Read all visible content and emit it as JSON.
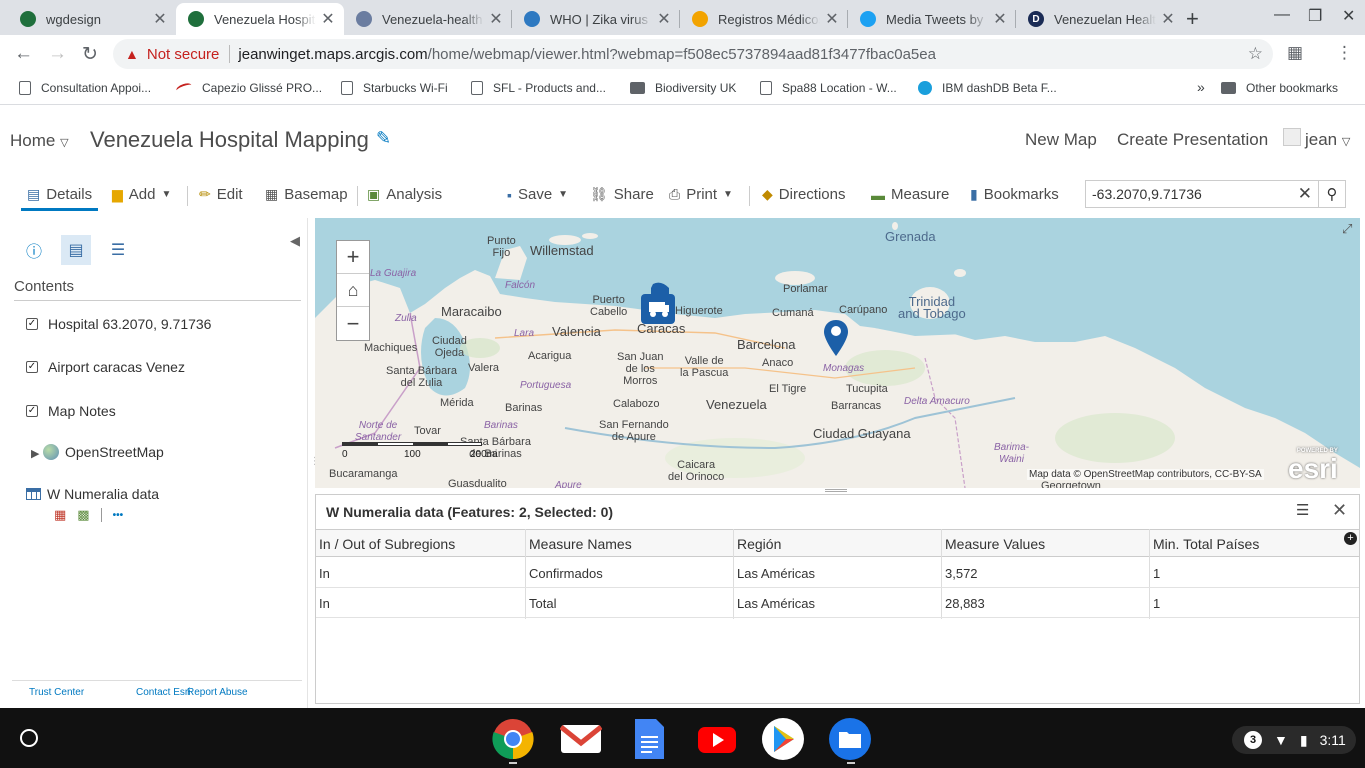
{
  "browser": {
    "tabs": [
      {
        "title": "wgdesign",
        "favicon_color": "#1f6f3c",
        "active": false
      },
      {
        "title": "Venezuela Hospital Mapping",
        "favicon_color": "#1f6f3c",
        "active": true
      },
      {
        "title": "Venezuela-health",
        "favicon_color": "#6b7da0",
        "active": false
      },
      {
        "title": "WHO | Zika virus",
        "favicon_color": "#2e79c1",
        "active": false
      },
      {
        "title": "Registros Médicos",
        "favicon_color": "#f2a300",
        "active": false
      },
      {
        "title": "Media Tweets by",
        "favicon_color": "#1da1f2",
        "active": false
      },
      {
        "title": "Venezuelan Health",
        "favicon_color": "#1a2b55",
        "active": false
      }
    ],
    "not_secure": "Not secure",
    "url_host": "jeanwinget.maps.arcgis.com",
    "url_path": "/home/webmap/viewer.html?webmap=f508ec5737894aad81f3477fbac0a5ea",
    "bookmarks": [
      {
        "label": "Consultation Appoi...",
        "icon": "page-icon"
      },
      {
        "label": "Capezio Glissé PRO...",
        "icon": "swoosh-icon"
      },
      {
        "label": "Starbucks Wi-Fi",
        "icon": "page-icon"
      },
      {
        "label": "SFL - Products and...",
        "icon": "page-icon"
      },
      {
        "label": "Biodiversity UK",
        "icon": "folder-icon"
      },
      {
        "label": "Spa88 Location - W...",
        "icon": "page-icon"
      },
      {
        "label": "IBM dashDB Beta F...",
        "icon": "ibm-icon"
      }
    ],
    "overflow": "»",
    "other_bookmarks": "Other bookmarks"
  },
  "header": {
    "home": "Home",
    "title": "Venezuela Hospital Mapping",
    "new_map": "New Map",
    "create_presentation": "Create Presentation",
    "user": "jean"
  },
  "toolbar": {
    "details": "Details",
    "add": "Add",
    "edit": "Edit",
    "basemap": "Basemap",
    "analysis": "Analysis",
    "save": "Save",
    "share": "Share",
    "print": "Print",
    "directions": "Directions",
    "measure": "Measure",
    "bookmarks": "Bookmarks",
    "search_value": "-63.2070,9.71736"
  },
  "contents": {
    "heading": "Contents",
    "layers": [
      {
        "label": "Hospital 63.2070, 9.71736",
        "checked": true
      },
      {
        "label": "Airport caracas Venez",
        "checked": true
      },
      {
        "label": "Map Notes",
        "checked": true
      }
    ],
    "basemap_layer": "OpenStreetMap",
    "table_layer": "W Numeralia data",
    "more": "•••",
    "footer": {
      "trust": "Trust Center",
      "contact": "Contact Esri",
      "abuse": "Report Abuse"
    }
  },
  "map": {
    "labels": {
      "grenada": "Grenada",
      "punto_fijo": "Punto\nFijo",
      "willemstad": "Willemstad",
      "la_guajira": "La Guajira",
      "falcon": "Falcón",
      "puerto_cabello": "Puerto\nCabello",
      "higuerote": "Higuerote",
      "porlamar": "Porlamar",
      "carupano": "Carúpano",
      "trinidad": "Trinidad\nand Tobago",
      "zulia": "Zulia",
      "maracaibo": "Maracaibo",
      "lara": "Lara",
      "valencia": "Valencia",
      "caracas": "Caracas",
      "cumana": "Cumaná",
      "machiques": "Machiques",
      "ciudad_ojeda": "Ciudad\nOjeda",
      "acarigua": "Acarigua",
      "san_juan": "San Juan\nde los\nMorros",
      "valle": "Valle de\nla Pascua",
      "barcelona": "Barcelona",
      "anaco": "Anaco",
      "monagas": "Monagas",
      "tucupita": "Tucupita",
      "santa_barbara_zulia": "Santa Bárbara\ndel Zulia",
      "valera": "Valera",
      "portuguesa": "Portuguesa",
      "el_tigre": "El Tigre",
      "delta": "Delta Amacuro",
      "merida": "Mérida",
      "barinas_city": "Barinas",
      "calabozo": "Calabozo",
      "venezuela": "Venezuela",
      "barrancas": "Barrancas",
      "norte": "Norte de\nSantander",
      "tovar": "Tovar",
      "barinas_state": "Barinas",
      "san_fernando": "San Fernando\nde Apure",
      "ciudad_guayana": "Ciudad Guayana",
      "santa_barbara": "Santa Bárbara\nde Barinas",
      "barima": "Barima-\nWaini",
      "bucaramanga": "Bucaramanga",
      "guasdualito": "Guasdualito",
      "apure": "Apure",
      "caicara": "Caicara\ndel Orinoco",
      "georgetown": "Georgetown"
    },
    "scale_labels": [
      "0",
      "100",
      "200mi"
    ],
    "attribution": "Map data © OpenStreetMap contributors, CC-BY-SA",
    "esri_powered": "POWERED BY",
    "esri": "esri"
  },
  "table": {
    "title": "W Numeralia data (Features: 2, Selected: 0)",
    "columns": [
      "In / Out of Subregions",
      "Measure Names",
      "Región",
      "Measure Values",
      "Min. Total Países"
    ],
    "rows": [
      [
        "In",
        "Confirmados",
        "Las Américas",
        "3,572",
        "1"
      ],
      [
        "In",
        "Total",
        "Las Américas",
        "28,883",
        "1"
      ]
    ]
  },
  "shelf": {
    "notification_count": "3",
    "time": "3:11"
  }
}
